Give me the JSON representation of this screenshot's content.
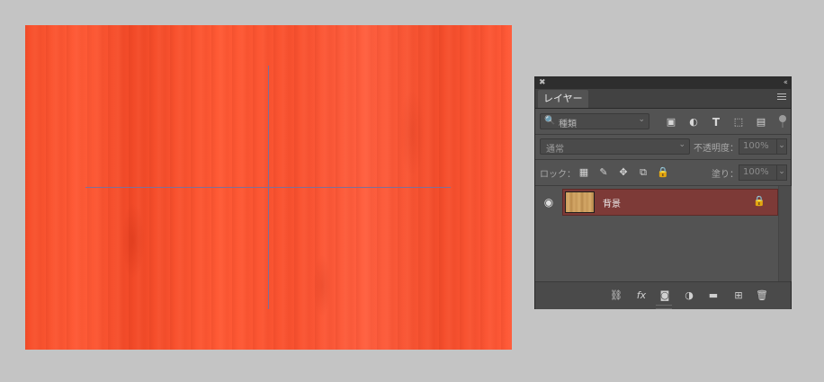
{
  "canvas": {
    "background": "#ff5a36",
    "guides": [
      "vertical",
      "horizontal"
    ]
  },
  "panel": {
    "close_glyph": "✖",
    "collapse_glyph": "‹‹",
    "tab_label": "レイヤー",
    "menu_icon": "panel-menu-icon",
    "filter": {
      "search_glyph": "🔍",
      "label": "種類",
      "chevron": "⌄",
      "icons": [
        "image-filter-icon",
        "adjustment-filter-icon",
        "type-filter-icon",
        "shape-filter-icon",
        "smart-object-filter-icon"
      ],
      "glyphs": {
        "image": "▣",
        "adjustment": "◐",
        "type": "T",
        "shape": "⬚",
        "smart": "▤"
      }
    },
    "blend_mode": {
      "value": "通常",
      "chevron": "⌄",
      "opacity_label": "不透明度：",
      "opacity_value": "100%",
      "opacity_chevron": "⌄"
    },
    "lock": {
      "label": "ロック：",
      "glyphs": {
        "pixels": "▦",
        "paint": "✎",
        "move": "✥",
        "artboard": "⧉",
        "all": "🔒"
      },
      "fill_label": "塗り：",
      "fill_value": "100%",
      "fill_chevron": "⌄"
    },
    "layers": [
      {
        "name": "背景",
        "visible_glyph": "◉",
        "lock_glyph": "🔒",
        "selected": true,
        "highlight": "#7d3a37"
      }
    ],
    "footer_glyphs": {
      "link": "⛓",
      "fx": "fx",
      "mask": "◙",
      "adjustment": "◑",
      "group": "▬",
      "new_layer": "⊞",
      "trash": "🗑"
    }
  }
}
